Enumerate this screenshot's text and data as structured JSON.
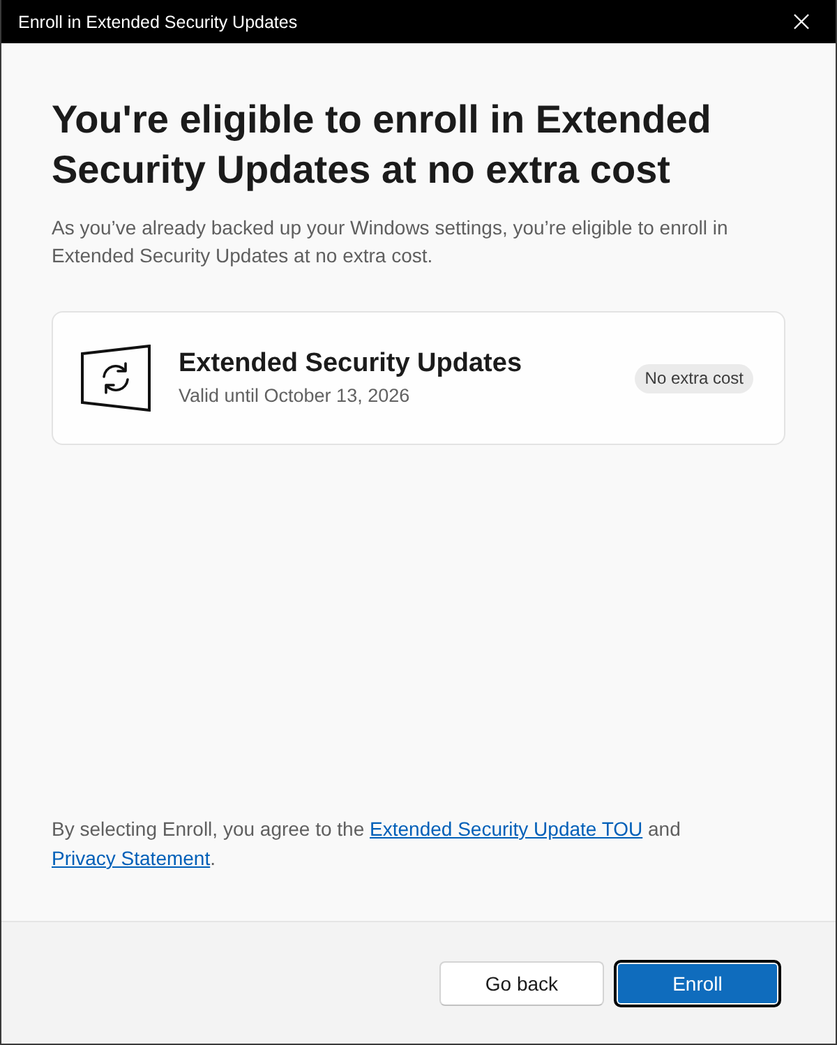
{
  "window": {
    "title": "Enroll in Extended Security Updates"
  },
  "heading": "You're eligible to enroll in Extended Security Updates at no extra cost",
  "description": "As you’ve already backed up your Windows settings, you’re eligible to enroll in Extended Security Updates at no extra cost.",
  "offer_card": {
    "title": "Extended Security Updates",
    "subtitle": "Valid until October 13, 2026",
    "badge": "No extra cost"
  },
  "agreement": [
    {
      "kind": "text",
      "text": "By selecting Enroll, you agree to the "
    },
    {
      "kind": "link",
      "text": "Extended Security Update TOU"
    },
    {
      "kind": "text",
      "text": " and "
    },
    {
      "kind": "link",
      "text": "Privacy Statement"
    },
    {
      "kind": "text",
      "text": "."
    }
  ],
  "buttons": [
    {
      "label": "Go back",
      "kind": "secondary",
      "focused": false
    },
    {
      "label": "Enroll",
      "kind": "primary",
      "focused": true
    }
  ]
}
